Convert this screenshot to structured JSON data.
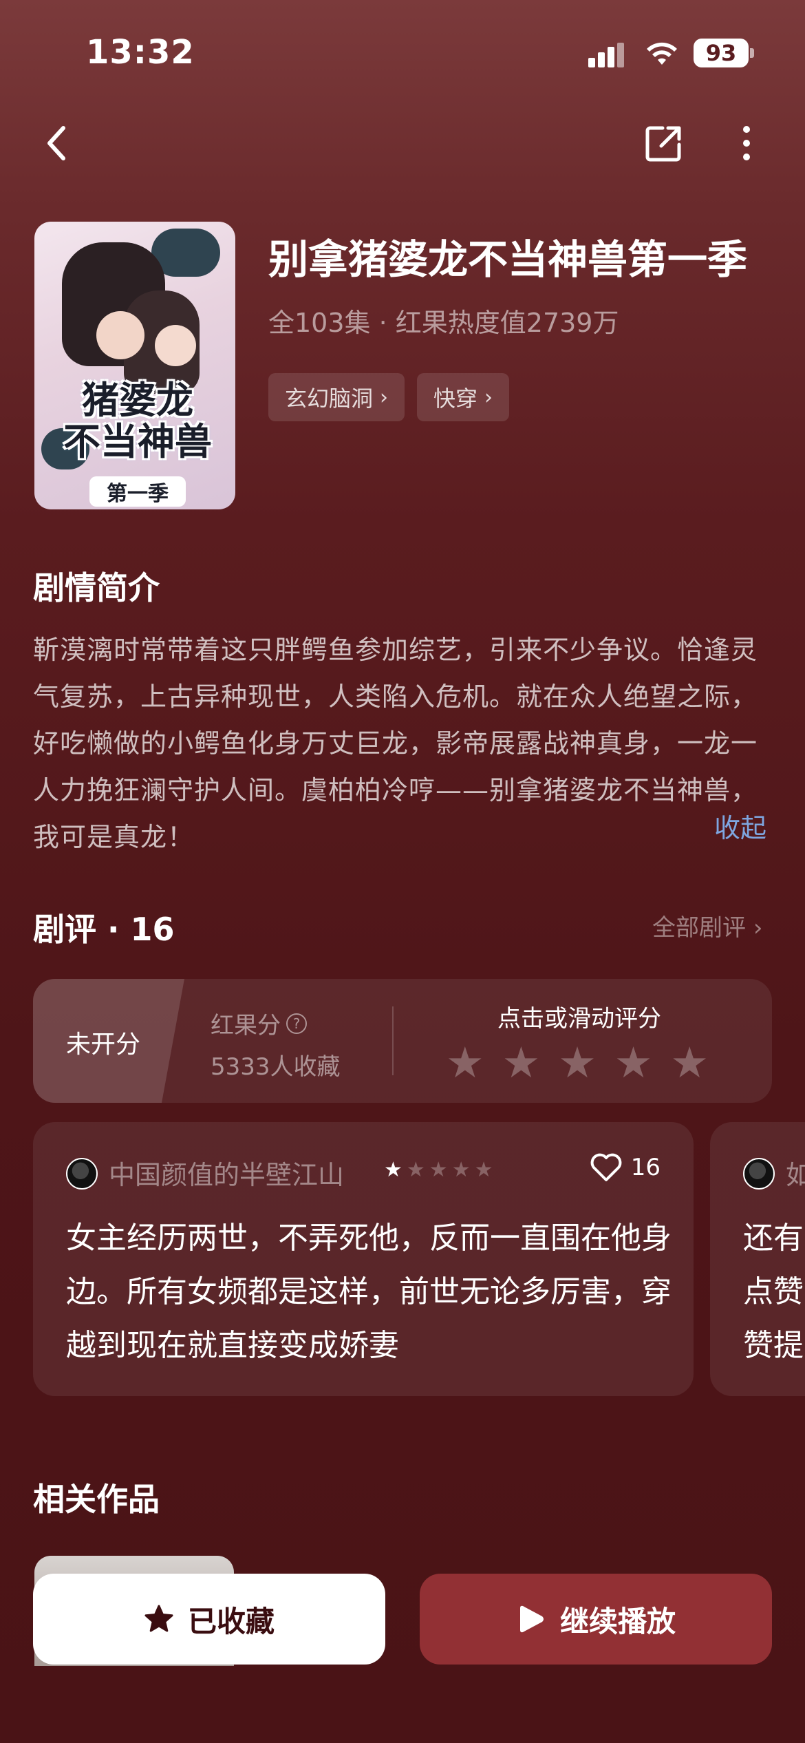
{
  "status_bar": {
    "time": "13:32",
    "battery": "93"
  },
  "show": {
    "title": "别拿猪婆龙不当神兽第一季",
    "meta": "全103集 · 红果热度值2739万",
    "tags": [
      {
        "label": "玄幻脑洞"
      },
      {
        "label": "快穿"
      }
    ],
    "poster": {
      "title_line1": "猪婆龙",
      "title_line2": "不当神兽",
      "subtitle": "第一季"
    }
  },
  "synopsis": {
    "heading": "剧情简介",
    "text": "靳漠漓时常带着这只胖鳄鱼参加综艺，引来不少争议。恰逢灵气复苏，上古异种现世，人类陷入危机。就在众人绝望之际，好吃懒做的小鳄鱼化身万丈巨龙，影帝展露战神真身，一龙一人力挽狂澜守护人间。虞柏柏冷哼——别拿猪婆龙不当神兽，我可是真龙！",
    "collapse_label": "收起"
  },
  "reviews": {
    "heading": "剧评 · 16",
    "all_label": "全部剧评",
    "rating": {
      "unrated_label": "未开分",
      "score_label": "红果分",
      "favorites": "5333人收藏",
      "prompt": "点击或滑动评分",
      "max_stars": 5
    },
    "items": [
      {
        "user": "中国颜值的半壁江山",
        "stars": 0.5,
        "likes": "16",
        "text": "女主经历两世，不弄死他，反而一直围在他身边。所有女频都是这样，前世无论多厉害，穿越到现在就直接变成娇妻"
      },
      {
        "user": "如",
        "text_lines": [
          "还有",
          "点赞",
          "赞提"
        ]
      }
    ]
  },
  "related": {
    "heading": "相关作品"
  },
  "actions": {
    "favorite_label": "已收藏",
    "play_label": "继续播放"
  },
  "colors": {
    "accent": "#923034",
    "link": "#7ea6e0",
    "background": "#5a1c1f"
  }
}
